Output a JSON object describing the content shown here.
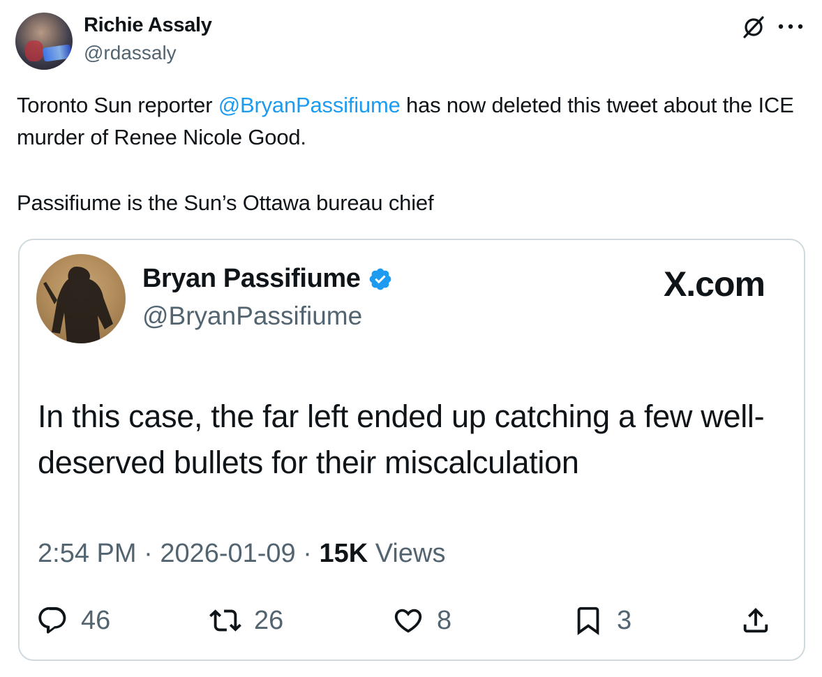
{
  "post": {
    "author": {
      "name": "Richie Assaly",
      "handle": "@rdassaly",
      "avatar_icon": "author-avatar"
    },
    "header_icons": [
      "grok-icon",
      "more-icon"
    ],
    "text": {
      "part1": "Toronto Sun reporter ",
      "mention": "@BryanPassifiume",
      "part2": " has now deleted this tweet about the ICE murder of Renee Nicole Good.",
      "paragraph2": "Passifiume is the Sun’s Ottawa bureau chief"
    }
  },
  "quoted_tweet": {
    "author": {
      "name": "Bryan Passifiume",
      "handle": "@BryanPassifiume",
      "verified": true,
      "verified_icon": "verified-badge-icon"
    },
    "source": "X.com",
    "text": "In this case, the far left ended up catching a few well-deserved bullets for their miscalculation",
    "meta": {
      "time": "2:54 PM",
      "separator": " · ",
      "date": "2026-01-09",
      "views_count": "15K",
      "views_label": " Views"
    },
    "actions": {
      "replies": "46",
      "reposts": "26",
      "likes": "8",
      "bookmarks": "3"
    }
  },
  "colors": {
    "text": "#0f1419",
    "secondary": "#536471",
    "link": "#1d9bf0",
    "border": "#cfd9de",
    "verified": "#1d9bf0"
  }
}
